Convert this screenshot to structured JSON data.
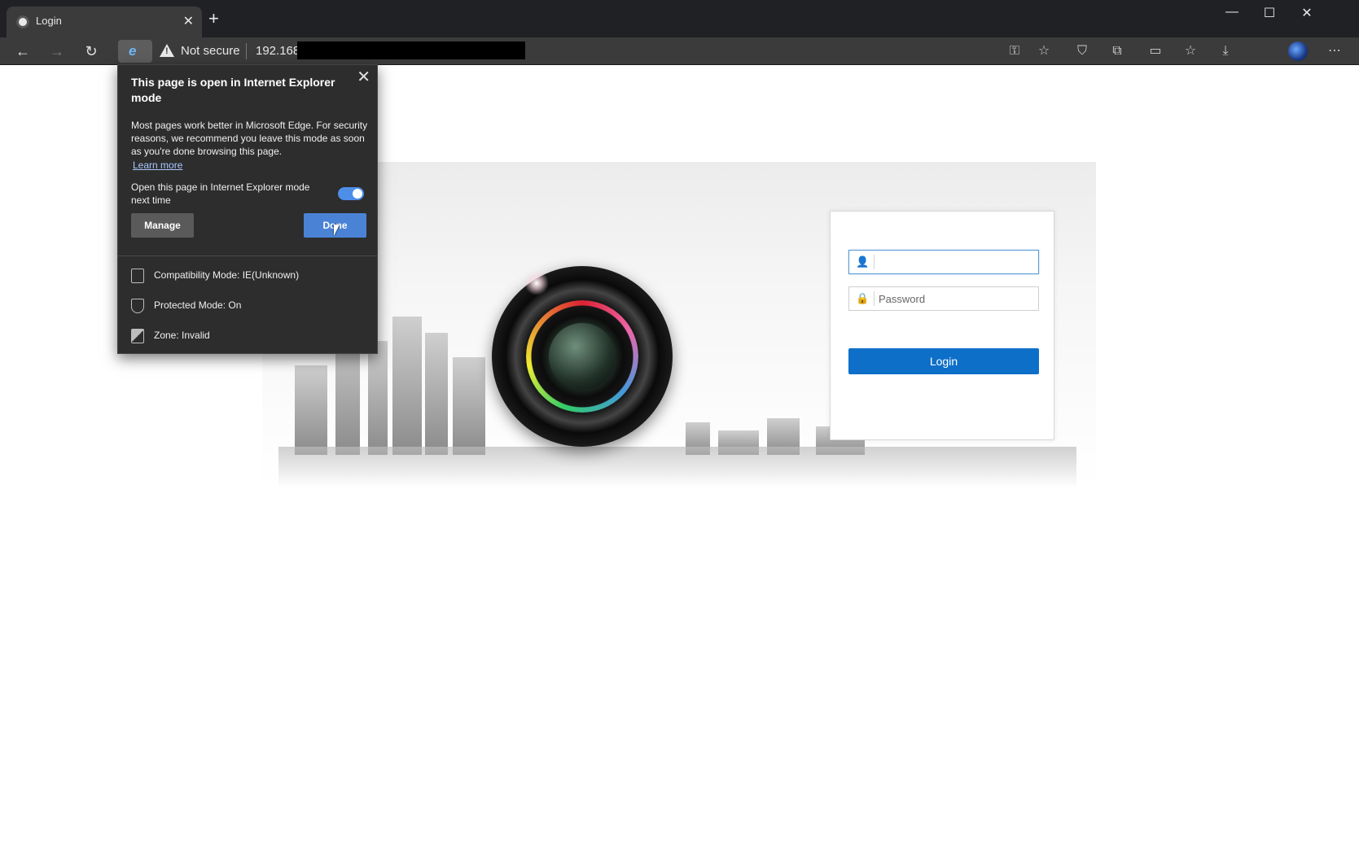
{
  "browser": {
    "tab": {
      "title": "Login"
    },
    "new_tab_glyph": "+",
    "tab_close_glyph": "✕",
    "window_controls": {
      "minimize": "—",
      "maximize": "☐",
      "close": "✕"
    },
    "toolbar": {
      "back": "←",
      "forward": "→",
      "refresh": "↻",
      "security_label": "Not secure",
      "url": "192.168.",
      "right_icons": {
        "key": "⚿",
        "favorite_add": "☆",
        "shield": "⛉",
        "extensions": "⧉",
        "cast": "▭",
        "favorites": "☆",
        "downloads": "⤓",
        "more": "⋯"
      }
    }
  },
  "ie_popup": {
    "close_glyph": "✕",
    "title": "This page is open in Internet Explorer mode",
    "body": "Most pages work better in Microsoft Edge. For security reasons, we recommend you leave this mode as soon as you're done browsing this page.",
    "learn_more": "Learn more",
    "toggle_label": "Open this page in Internet Explorer mode next time",
    "toggle_on": true,
    "manage_label": "Manage",
    "done_label": "Done",
    "info": {
      "compatibility": "Compatibility Mode: IE(Unknown)",
      "protected": "Protected Mode: On",
      "zone": "Zone: Invalid"
    }
  },
  "login": {
    "username": {
      "value": "",
      "placeholder": ""
    },
    "password": {
      "value": "",
      "placeholder": "Password"
    },
    "user_icon_glyph": "👤",
    "lock_icon_glyph": "🔒",
    "button_label": "Login"
  },
  "colors": {
    "login_button": "#0e6fc9",
    "done_button": "#4a83d6",
    "toggle": "#4e8ee8",
    "chrome_dark": "#202124",
    "toolbar": "#3b3b3b",
    "popup_bg": "#2d2d2d"
  }
}
